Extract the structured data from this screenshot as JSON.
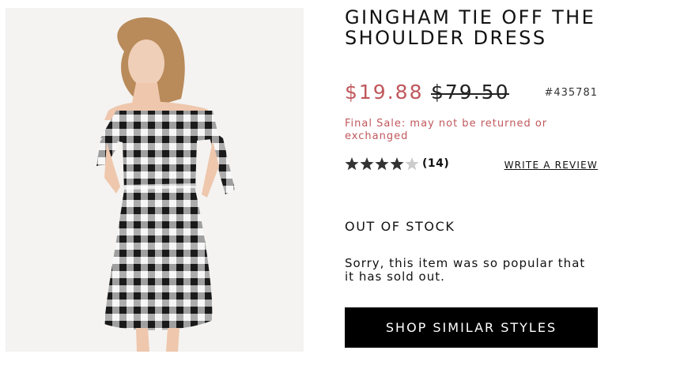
{
  "product": {
    "title": "GINGHAM TIE OFF THE SHOULDER DRESS",
    "sale_price": "$19.88",
    "original_price": "$79.50",
    "sku": "#435781",
    "final_sale_note": "Final Sale: may not be returned or exchanged",
    "rating": 4,
    "rating_max": 5,
    "review_count": "(14)",
    "write_review_label": "WRITE A REVIEW",
    "stock_status": "OUT OF STOCK",
    "sold_out_message": "Sorry, this item was so popular that it has sold out.",
    "shop_similar_label": "SHOP SIMILAR STYLES"
  },
  "colors": {
    "sale": "#c0585c",
    "button_bg": "#000000",
    "button_text": "#ffffff",
    "star_filled": "#333333",
    "star_empty": "#cccccc"
  }
}
